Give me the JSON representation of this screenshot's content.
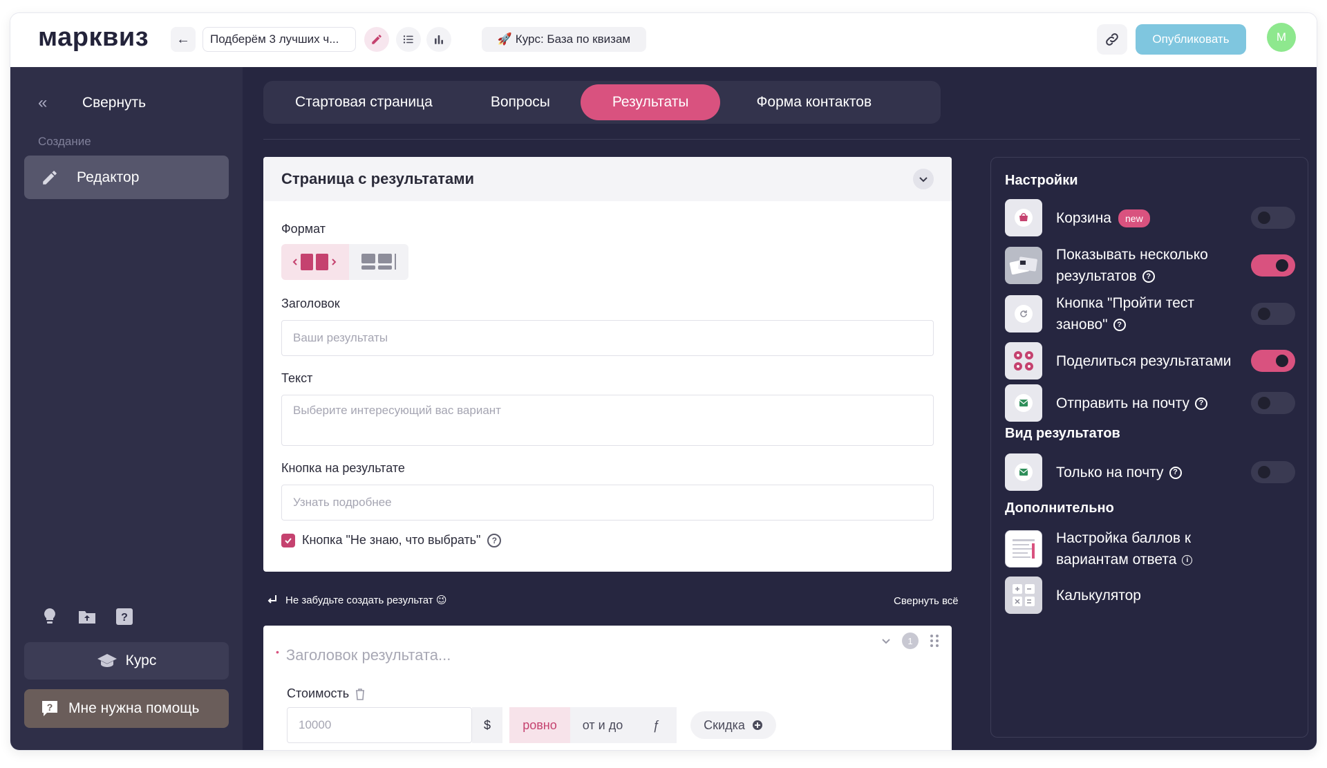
{
  "app": {
    "logo": "марквиз",
    "quiz_title": "Подберём 3 лучших ч...",
    "course_chip": "🚀 Курс: База по квизам",
    "publish_label": "Опубликовать",
    "avatar_letter": "М"
  },
  "sidebar": {
    "collapse_label": "Свернуть",
    "section_label": "Создание",
    "editor_label": "Редактор",
    "course_label": "Курс",
    "help_label": "Мне нужна помощь"
  },
  "tabs": [
    {
      "label": "Стартовая страница",
      "active": false
    },
    {
      "label": "Вопросы",
      "active": false
    },
    {
      "label": "Результаты",
      "active": true
    },
    {
      "label": "Форма контактов",
      "active": false
    }
  ],
  "results_card": {
    "title": "Страница с результатами",
    "format_label": "Формат",
    "heading_label": "Заголовок",
    "heading_placeholder": "Ваши результаты",
    "text_label": "Текст",
    "text_placeholder": "Выберите интересующий вас вариант",
    "button_label": "Кнопка на результате",
    "button_placeholder": "Узнать подробнее",
    "checkbox_label": "Кнопка \"Не знаю, что выбрать\"",
    "checkbox_checked": true
  },
  "reminder": {
    "text": "Не забудьте создать результат 😉",
    "collapse_all": "Свернуть всё"
  },
  "result_item": {
    "title_placeholder": "Заголовок результата...",
    "number": "1",
    "cost_label": "Стоимость",
    "cost_placeholder": "10000",
    "currency": "$",
    "modes": [
      "ровно",
      "от и до",
      "ƒ"
    ],
    "active_mode": "ровно",
    "discount_label": "Скидка"
  },
  "settings": {
    "heading": "Настройки",
    "items": [
      {
        "label": "Корзина",
        "badge": "new",
        "toggle": false
      },
      {
        "label": "Показывать несколько результатов",
        "help": true,
        "toggle": true
      },
      {
        "label": "Кнопка \"Пройти тест заново\"",
        "help": true,
        "toggle": false
      },
      {
        "label": "Поделиться результатами",
        "toggle": true
      },
      {
        "label": "Отправить на почту",
        "help": true,
        "toggle": false
      }
    ],
    "view_heading": "Вид результатов",
    "view_items": [
      {
        "label": "Только на почту",
        "help": true,
        "toggle": false
      }
    ],
    "extra_heading": "Дополнительно",
    "extra_items": [
      {
        "label": "Настройка баллов к вариантам ответа",
        "info": true
      },
      {
        "label": "Калькулятор"
      }
    ]
  },
  "colors": {
    "accent": "#d9527f",
    "sidebar_bg": "#2f2f48",
    "main_bg": "#262640",
    "publish_bg": "#7fc6df",
    "avatar_bg": "#8ee88e"
  }
}
